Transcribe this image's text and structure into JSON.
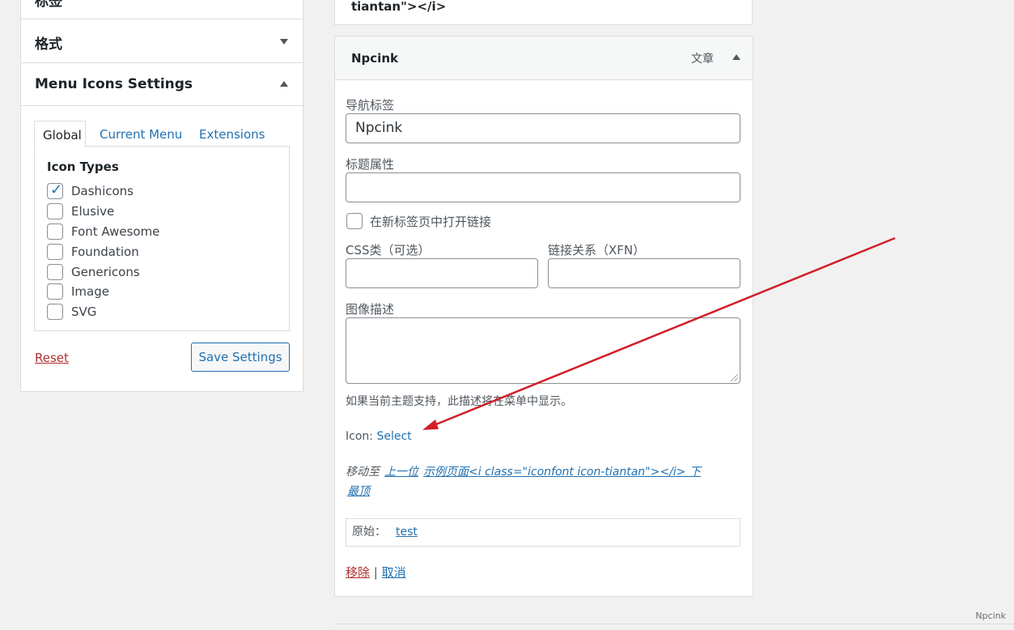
{
  "left_panel": {
    "collapsed_header_partial": "标签",
    "format_header": "格式",
    "menu_icons_header": "Menu Icons Settings",
    "tabs": [
      "Global",
      "Current Menu",
      "Extensions"
    ],
    "active_tab": "Global",
    "icon_types_title": "Icon Types",
    "icon_types": [
      {
        "label": "Dashicons",
        "checked": true
      },
      {
        "label": "Elusive",
        "checked": false
      },
      {
        "label": "Font Awesome",
        "checked": false
      },
      {
        "label": "Foundation",
        "checked": false
      },
      {
        "label": "Genericons",
        "checked": false
      },
      {
        "label": "Image",
        "checked": false
      },
      {
        "label": "SVG",
        "checked": false
      }
    ],
    "reset_label": "Reset",
    "save_label": "Save Settings"
  },
  "top_fragment": "tiantan\"></i>",
  "menu_item": {
    "title": "Npcink",
    "item_type": "文章",
    "nav_label_label": "导航标签",
    "nav_label_value": "Npcink",
    "title_attr_label": "标题属性",
    "title_attr_value": "",
    "new_tab_label": "在新标签页中打开链接",
    "css_class_label": "CSS类（可选）",
    "css_class_value": "",
    "xfn_label": "链接关系（XFN）",
    "xfn_value": "",
    "desc_label": "图像描述",
    "desc_value": "",
    "desc_hint": "如果当前主题支持，此描述将在菜单中显示。",
    "icon_prefix": "Icon:",
    "icon_select": "Select",
    "move_to_label": "移动至",
    "move_up": "上一位",
    "move_under": "示例页面<i class=\"iconfont icon-tiantan\"></i> 下",
    "move_top": "最顶",
    "original_label": "原始：",
    "original_link": "test",
    "remove_label": "移除",
    "separator": "|",
    "cancel_label": "取消"
  },
  "watermark": "Npcink",
  "colors": {
    "link": "#2271b1",
    "danger": "#b32d2e",
    "annotation_arrow": "#d0202a"
  }
}
